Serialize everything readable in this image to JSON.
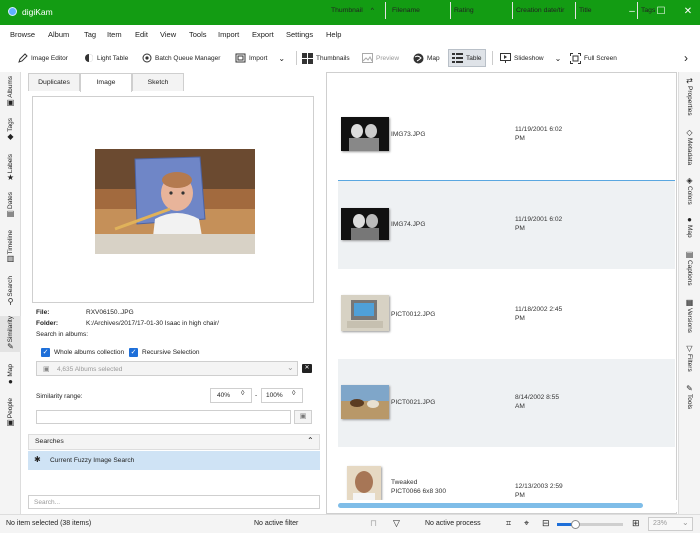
{
  "window": {
    "title": "digiKam",
    "buttons": [
      "–",
      "☐",
      "✕"
    ]
  },
  "menu": [
    "Browse",
    "Album",
    "Tag",
    "Item",
    "Edit",
    "View",
    "Tools",
    "Import",
    "Export",
    "Settings",
    "Help"
  ],
  "toolbar": {
    "image_editor": "Image Editor",
    "light_table": "Light Table",
    "batch_queue": "Batch Queue Manager",
    "import": "Import",
    "thumbnails": "Thumbnails",
    "preview": "Preview",
    "map": "Map",
    "table": "Table",
    "slideshow": "Slideshow",
    "full_screen": "Full Screen",
    "more": "›"
  },
  "left_sidebar": [
    "Albums",
    "Tags",
    "Labels",
    "Dates",
    "Timeline",
    "Search",
    "Similarity",
    "Map",
    "People"
  ],
  "right_sidebar": [
    "Properties",
    "Metadata",
    "Colors",
    "Map",
    "Captions",
    "Versions",
    "Filters",
    "Tools"
  ],
  "similarity": {
    "tabs": [
      "Duplicates",
      "Image",
      "Sketch"
    ],
    "file_label": "File:",
    "file_value": "RXV06150..JPG",
    "folder_label": "Folder:",
    "folder_value": "K:/Archives/2017/17-01-30 Isaac in high chair/",
    "search_in": "Search in albums:",
    "whole_albums": "Whole albums collection",
    "recursive": "Recursive Selection",
    "albums_selected": "4,635 Albums selected",
    "range_label": "Similarity range:",
    "range_min": "40%",
    "range_sep": "-",
    "range_max": "100%",
    "searches_title": "Searches",
    "search_item": "Current Fuzzy Image Search",
    "search_placeholder": "Search..."
  },
  "table": {
    "headers": [
      "Thumbnail",
      "Filename",
      "Rating",
      "Creation date/tir",
      "Title",
      "Tags"
    ],
    "rows": [
      {
        "filename": "IMG73.JPG",
        "date": "11/19/2001 6:02",
        "time": "PM",
        "tweak": ""
      },
      {
        "filename": "IMG74.JPG",
        "date": "11/19/2001 6:02",
        "time": "PM",
        "tweak": ""
      },
      {
        "filename": "PICT0012.JPG",
        "date": "11/18/2002 2:45",
        "time": "PM",
        "tweak": ""
      },
      {
        "filename": "PICT0021.JPG",
        "date": "8/14/2002 8:55",
        "time": "AM",
        "tweak": ""
      },
      {
        "filename": "PICT0066 6x8 300",
        "date": "12/13/2003 2:59",
        "time": "PM",
        "tweak": "Tweaked"
      }
    ]
  },
  "status": {
    "left": "No item selected (38 items)",
    "filter": "No active filter",
    "process": "No active process",
    "zoom": "23%"
  },
  "colors": {
    "titlebar": "#139c13",
    "accent": "#1e6fd9",
    "selection": "#cfe3f5"
  }
}
